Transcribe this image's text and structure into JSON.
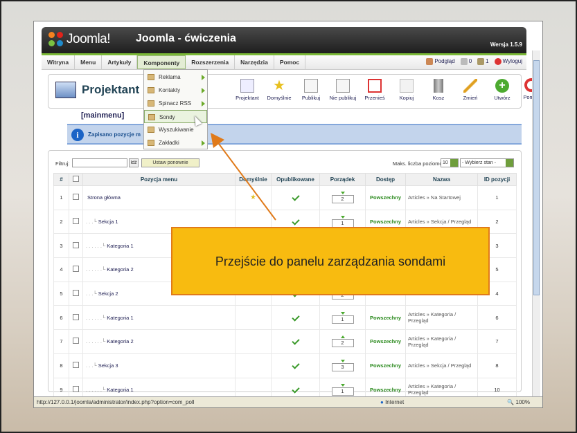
{
  "header": {
    "brand": "Joomla!",
    "site_title": "Joomla - ćwiczenia",
    "version": "Wersja 1.5.9"
  },
  "menu": [
    "Witryna",
    "Menu",
    "Artykuły",
    "Komponenty",
    "Rozszerzenia",
    "Narzędzia",
    "Pomoc"
  ],
  "right_links": {
    "preview": "Podgląd",
    "messages": "0",
    "users": "1",
    "logout": "Wyloguj"
  },
  "dropdown": [
    {
      "label": "Reklama",
      "has_sub": true
    },
    {
      "label": "Kontakty",
      "has_sub": true
    },
    {
      "label": "Spinacz RSS",
      "has_sub": true
    },
    {
      "label": "Sondy",
      "has_sub": false
    },
    {
      "label": "Wyszukiwanie",
      "has_sub": false
    },
    {
      "label": "Zakładki",
      "has_sub": true
    }
  ],
  "page_title": "Projektant p",
  "page_title_suffix": ":",
  "toolbar": [
    "Projektant",
    "Domyślnie",
    "Publikuj",
    "Nie publikuj",
    "Przenieś",
    "Kopiuj",
    "Kosz",
    "Zmień",
    "Utwórz",
    "Pomoc"
  ],
  "submenu_name": "[mainmenu]",
  "message": "Zapisano pozycje m",
  "filter": {
    "label": "Filtruj:",
    "go": "Idź",
    "reset": "Ustaw ponownie",
    "levels_label": "Maks. liczba poziomów",
    "levels_value": "10",
    "state_value": "- Wybierz stan -"
  },
  "columns": [
    "#",
    "",
    "Pozycja menu",
    "Domyślnie",
    "Opublikowane",
    "Porządek",
    "Dostęp",
    "Nazwa",
    "ID pozycji"
  ],
  "rows": [
    {
      "n": "1",
      "name": "Strona główna",
      "indent": "",
      "default": true,
      "pub": true,
      "order": "2",
      "access": "Powszechny",
      "type": "Articles » Na Startowej",
      "id": "1"
    },
    {
      "n": "2",
      "name": "Sekcja 1",
      "indent": ". . .└",
      "default": false,
      "pub": true,
      "order": "1",
      "access": "Powszechny",
      "type": "Articles » Sekcja / Przegląd",
      "id": "2"
    },
    {
      "n": "3",
      "name": "Kategoria 1",
      "indent": ". . . . . .└",
      "default": false,
      "pub": true,
      "order": "",
      "access": "",
      "type": "",
      "id": "3"
    },
    {
      "n": "4",
      "name": "Kategoria 2",
      "indent": ". . . . . .└",
      "default": false,
      "pub": true,
      "order": "",
      "access": "",
      "type": "",
      "id": "5"
    },
    {
      "n": "5",
      "name": "Sekcja 2",
      "indent": ". . .└",
      "default": false,
      "pub": true,
      "order": "2",
      "access": "",
      "type": "",
      "id": "4"
    },
    {
      "n": "6",
      "name": "Kategoria 1",
      "indent": ". . . . . .└",
      "default": false,
      "pub": true,
      "order": "1",
      "access": "Powszechny",
      "type": "Articles » Kategoria / Przegląd",
      "id": "6"
    },
    {
      "n": "7",
      "name": "Kategoria 2",
      "indent": ". . . . . .└",
      "default": false,
      "pub": true,
      "order": "2",
      "access": "Powszechny",
      "type": "Articles » Kategoria / Przegląd",
      "id": "7"
    },
    {
      "n": "8",
      "name": "Sekcja 3",
      "indent": ". . .└",
      "default": false,
      "pub": true,
      "order": "3",
      "access": "Powszechny",
      "type": "Articles » Sekcja / Przegląd",
      "id": "8"
    },
    {
      "n": "9",
      "name": "Kategoria 1",
      "indent": ". . . . . .└",
      "default": false,
      "pub": true,
      "order": "1",
      "access": "Powszechny",
      "type": "Articles » Kategoria / Przegląd",
      "id": "10"
    }
  ],
  "status": {
    "url": "http://127.0.0.1/joomla/administrator/index.php?option=com_poll",
    "zone": "Internet",
    "zoom": "100%"
  },
  "callout": "Przejście do panelu zarządzania sondami"
}
